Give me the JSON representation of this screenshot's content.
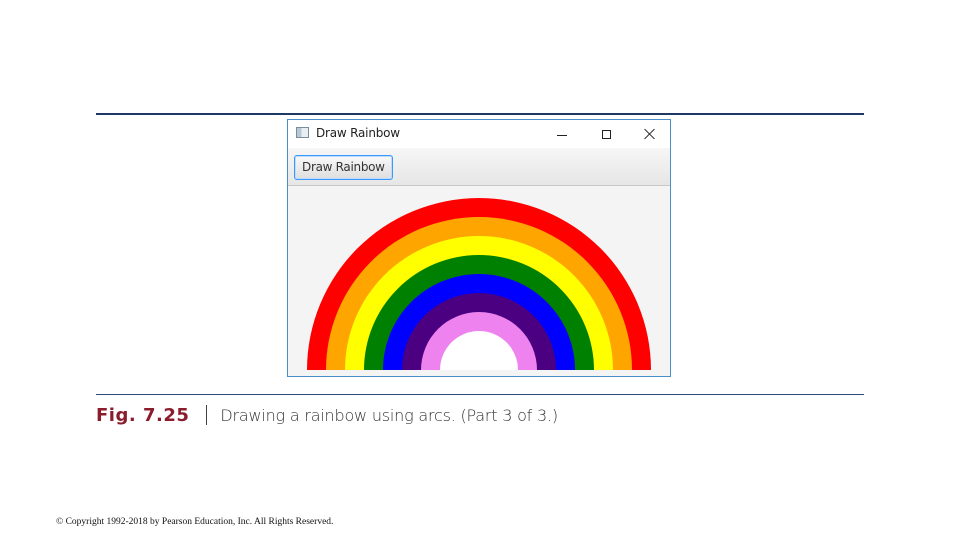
{
  "window": {
    "title": "Draw Rainbow",
    "controls": {
      "minimize_icon": "minimize-icon",
      "maximize_icon": "maximize-icon",
      "close_icon": "close-icon"
    },
    "border_color": "#4a90c8"
  },
  "toolbar": {
    "draw_button_label": "Draw Rainbow"
  },
  "rainbow": {
    "colors": [
      "#ff0000",
      "#ffa500",
      "#ffff00",
      "#008000",
      "#0000ff",
      "#4b0082",
      "#ee82ee"
    ],
    "center_color": "#ffffff"
  },
  "caption": {
    "figure_label": "Fig. 7.25",
    "text": "Drawing a rainbow using arcs. (Part 3 of 3.)",
    "label_color": "#8b1c2c"
  },
  "footer": {
    "copyright": "© Copyright 1992-2018 by Pearson Education, Inc. All Rights Reserved."
  }
}
